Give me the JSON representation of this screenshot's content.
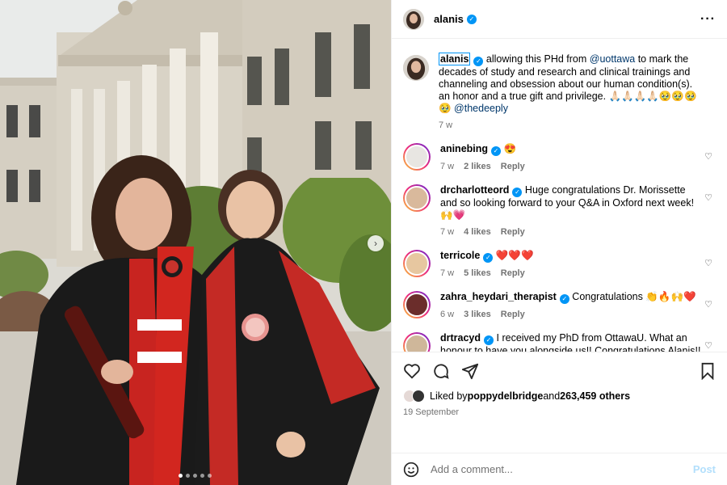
{
  "header": {
    "username": "alanis"
  },
  "caption": {
    "username": "alanis",
    "text_before_link": "allowing this PHd from ",
    "link1": "@uottawa",
    "text_after_link": " to mark the decades of study and research and clinical trainings and channeling and obsession about our human condition(s). an honor and a true gift and privilege. 🙏🏻🙏🏻🙏🏻🙏🏻🥹🥹🥹🥹 ",
    "link2": "@thedeeply",
    "time": "7 w"
  },
  "comments": [
    {
      "user": "aninebing",
      "text": "😍",
      "time": "7 w",
      "likes": "2 likes",
      "reply": "Reply"
    },
    {
      "user": "drcharlotteord",
      "text": "Huge congratulations Dr. Morissette and so looking forward to your Q&A in Oxford next week! 🙌💗",
      "time": "7 w",
      "likes": "4 likes",
      "reply": "Reply"
    },
    {
      "user": "terricole",
      "text": "❤️❤️❤️",
      "time": "7 w",
      "likes": "5 likes",
      "reply": "Reply"
    },
    {
      "user": "zahra_heydari_therapist",
      "text": "Congratulations 👏🔥🙌❤️",
      "time": "6 w",
      "likes": "3 likes",
      "reply": "Reply"
    },
    {
      "user": "drtracyd",
      "text": "I received my PhD from OttawaU. What an honour to have you alongside us!! Congratulations Alanis!! ❤️ You're doing so much for mental health. And your talk with the Psychotherapy Networker in 2023 impacted hundreds of therapists too.",
      "time": "",
      "likes": "",
      "reply": ""
    }
  ],
  "likes": {
    "prefix": "Liked by ",
    "user": "poppydelbridge",
    "mid": " and ",
    "count": "263,459 others"
  },
  "date": "19 September",
  "add_comment": {
    "placeholder": "Add a comment...",
    "post": "Post"
  },
  "carousel": {
    "slides": 5,
    "active": 0
  },
  "icons": [
    "heart-icon",
    "comment-icon",
    "share-icon",
    "bookmark-icon",
    "emoji-icon",
    "more-icon",
    "verified-icon",
    "chevron-right-icon"
  ]
}
